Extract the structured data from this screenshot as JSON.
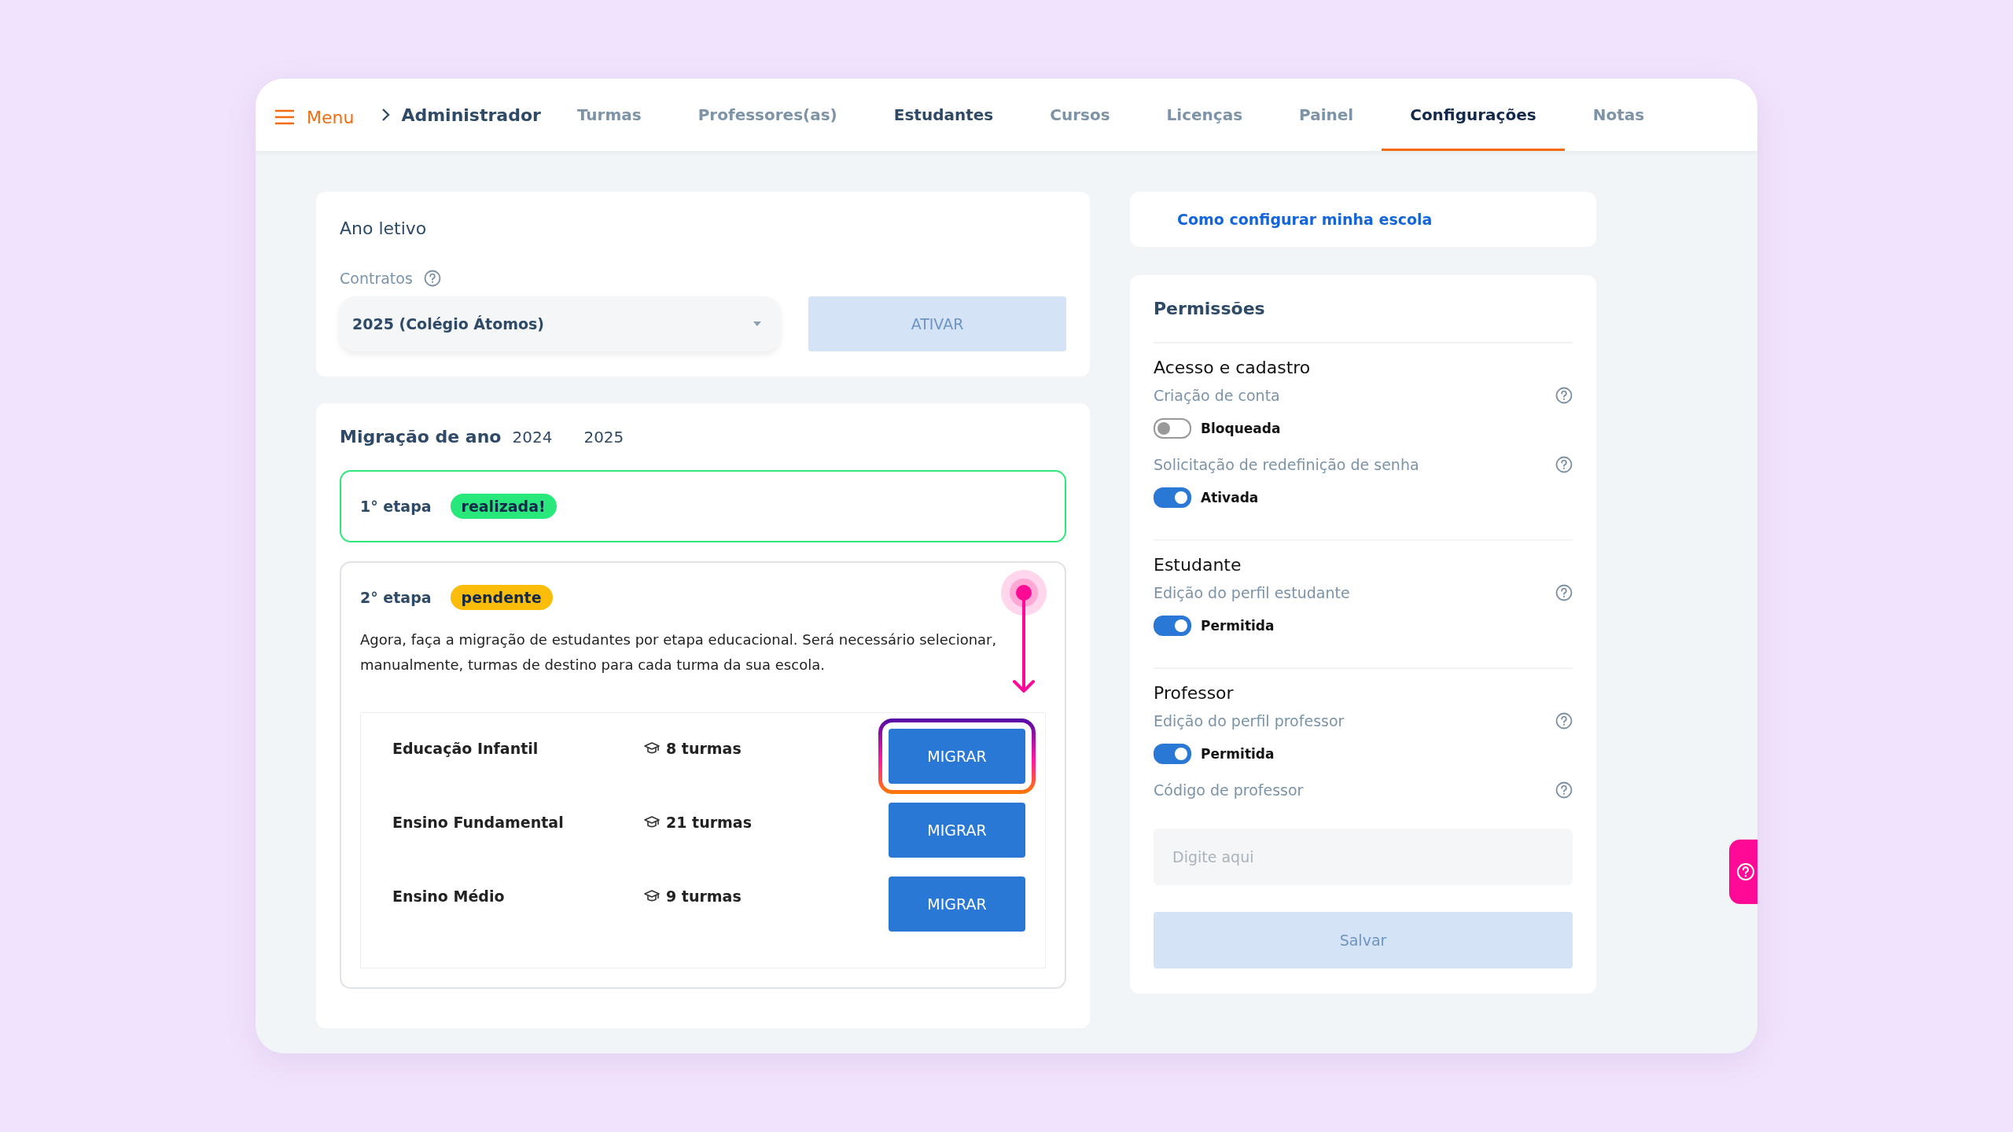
{
  "nav": {
    "menu_label": "Menu",
    "breadcrumb": "Administrador",
    "tabs": [
      {
        "label": "Turmas",
        "selected": false,
        "hovered": false
      },
      {
        "label": "Professores(as)",
        "selected": false,
        "hovered": false
      },
      {
        "label": "Estudantes",
        "selected": false,
        "hovered": true
      },
      {
        "label": "Cursos",
        "selected": false,
        "hovered": false
      },
      {
        "label": "Licenças",
        "selected": false,
        "hovered": false
      },
      {
        "label": "Painel",
        "selected": false,
        "hovered": false
      },
      {
        "label": "Configurações",
        "selected": true,
        "hovered": false
      },
      {
        "label": "Notas",
        "selected": false,
        "hovered": false
      }
    ]
  },
  "school_year": {
    "title": "Ano letivo",
    "contracts_label": "Contratos",
    "contract_value": "2025 (Colégio Átomos)",
    "activate_button": {
      "label": "ATIVAR",
      "disabled": true
    }
  },
  "migration": {
    "title": "Migração de ano",
    "years": [
      "2024",
      "2025"
    ],
    "steps": [
      {
        "label": "1° etapa",
        "status": "realizada!",
        "kind": "done"
      },
      {
        "label": "2° etapa",
        "status": "pendente",
        "kind": "pending",
        "description": "Agora, faça a migração de estudantes por etapa educacional. Será necessário selecionar, manualmente, turmas de destino para cada turma da sua escola.",
        "segments": [
          {
            "name": "Educação Infantil",
            "classes": "8 turmas",
            "button": "MIGRAR",
            "highlighted": true
          },
          {
            "name": "Ensino Fundamental",
            "classes": "21 turmas",
            "button": "MIGRAR",
            "highlighted": false
          },
          {
            "name": "Ensino Médio",
            "classes": "9 turmas",
            "button": "MIGRAR",
            "highlighted": false
          }
        ]
      }
    ]
  },
  "help_link": "Como configurar minha escola",
  "permissions": {
    "title": "Permissões",
    "sections": [
      {
        "title": "Acesso e cadastro",
        "settings": [
          {
            "kind": "toggle",
            "label": "Criação de conta",
            "on": false,
            "state_label": "Bloqueada"
          },
          {
            "kind": "toggle",
            "label": "Solicitação de redefinição de senha",
            "on": true,
            "state_label": "Ativada"
          }
        ]
      },
      {
        "title": "Estudante",
        "settings": [
          {
            "kind": "toggle",
            "label": "Edição do perfil estudante",
            "on": true,
            "state_label": "Permitida"
          }
        ]
      },
      {
        "title": "Professor",
        "settings": [
          {
            "kind": "toggle",
            "label": "Edição do perfil professor",
            "on": true,
            "state_label": "Permitida"
          },
          {
            "kind": "text",
            "label": "Código de professor",
            "placeholder": "Digite aqui"
          }
        ]
      }
    ],
    "save_button": {
      "label": "Salvar",
      "disabled": true
    }
  }
}
